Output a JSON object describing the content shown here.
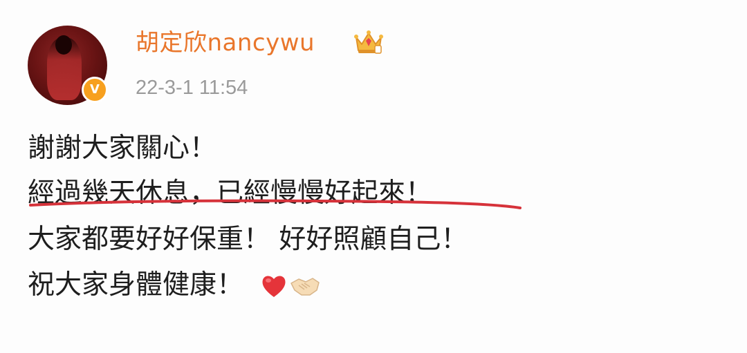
{
  "post": {
    "author": "胡定欣nancywu",
    "timestamp": "22-3-1 11:54",
    "lines": [
      "謝謝大家關心！",
      "經過幾天休息，已經慢慢好起來！",
      "大家都要好好保重！ 好好照顧自己！",
      "祝大家身體健康！"
    ],
    "verified_badge": "V",
    "icons": [
      "avatar-photo",
      "verified-badge",
      "crown-icon",
      "heart-emoji",
      "handshake-emoji"
    ],
    "colors": {
      "author": "#e9762b",
      "timestamp": "#9a9a9a",
      "text": "#1e1e1e",
      "underline": "#d6323a",
      "badge": "#f7a01f"
    }
  }
}
